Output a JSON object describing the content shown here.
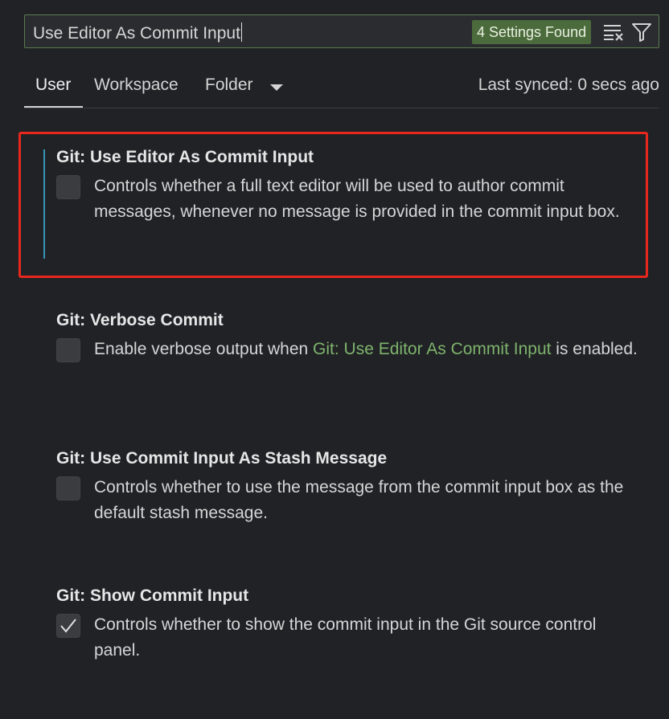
{
  "search": {
    "value": "Use Editor As Commit Input",
    "results_badge": "4 Settings Found"
  },
  "icons": {
    "clear": "clear-filter-icon",
    "filter": "filter-icon"
  },
  "tabs": {
    "user": "User",
    "workspace": "Workspace",
    "folder": "Folder",
    "last_synced": "Last synced: 0 secs ago"
  },
  "settings": [
    {
      "title": "Git: Use Editor As Commit Input",
      "description": "Controls whether a full text editor will be used to author commit messages, whenever no message is provided in the commit input box.",
      "checked": false
    },
    {
      "title": "Git: Verbose Commit",
      "description_prefix": "Enable verbose output when ",
      "description_link": "Git: Use Editor As Commit Input",
      "description_suffix": " is enabled.",
      "checked": false
    },
    {
      "title": "Git: Use Commit Input As Stash Message",
      "description": "Controls whether to use the message from the commit input box as the default stash message.",
      "checked": false
    },
    {
      "title": "Git: Show Commit Input",
      "description": "Controls whether to show the commit input in the Git source control panel.",
      "checked": true
    }
  ],
  "colors": {
    "background": "#202226",
    "link": "#7fb36b",
    "badge": "#4c6b3c",
    "highlight": "#e8271d",
    "focus_bar": "#3794b8"
  }
}
